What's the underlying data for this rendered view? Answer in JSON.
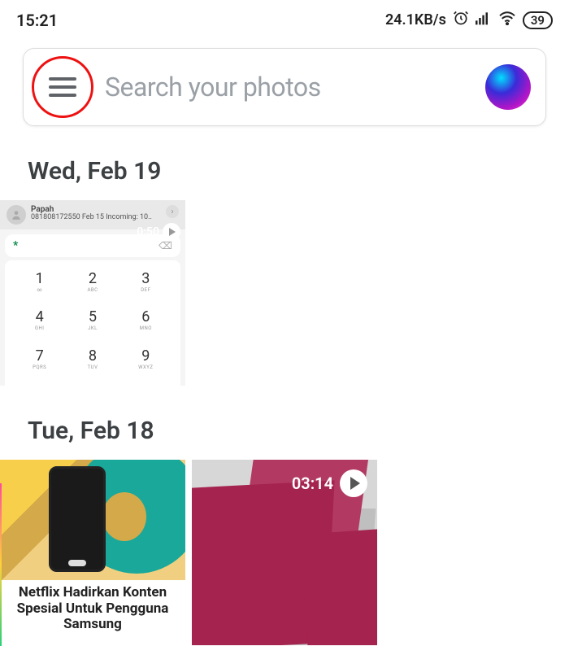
{
  "status": {
    "time": "15:21",
    "speed": "24.1KB/s",
    "battery": "39"
  },
  "search": {
    "placeholder": "Search your photos"
  },
  "sections": [
    {
      "header": "Wed, Feb 19"
    },
    {
      "header": "Tue, Feb 18"
    }
  ],
  "dialer": {
    "name": "Papah",
    "subtitle": "081808172550 Feb 15 Incoming: 10..",
    "duration": "0:50",
    "input_star": "*",
    "keys": [
      {
        "n": "1",
        "s": "∞"
      },
      {
        "n": "2",
        "s": "ABC"
      },
      {
        "n": "3",
        "s": "DEF"
      },
      {
        "n": "4",
        "s": "GHI"
      },
      {
        "n": "5",
        "s": "JKL"
      },
      {
        "n": "6",
        "s": "MNO"
      },
      {
        "n": "7",
        "s": "PQRS"
      },
      {
        "n": "8",
        "s": "TUV"
      },
      {
        "n": "9",
        "s": "WXYZ"
      }
    ]
  },
  "news": {
    "headline": "Netflix Hadirkan Konten Spesial Untuk Pengguna Samsung"
  },
  "video": {
    "duration": "03:14"
  }
}
